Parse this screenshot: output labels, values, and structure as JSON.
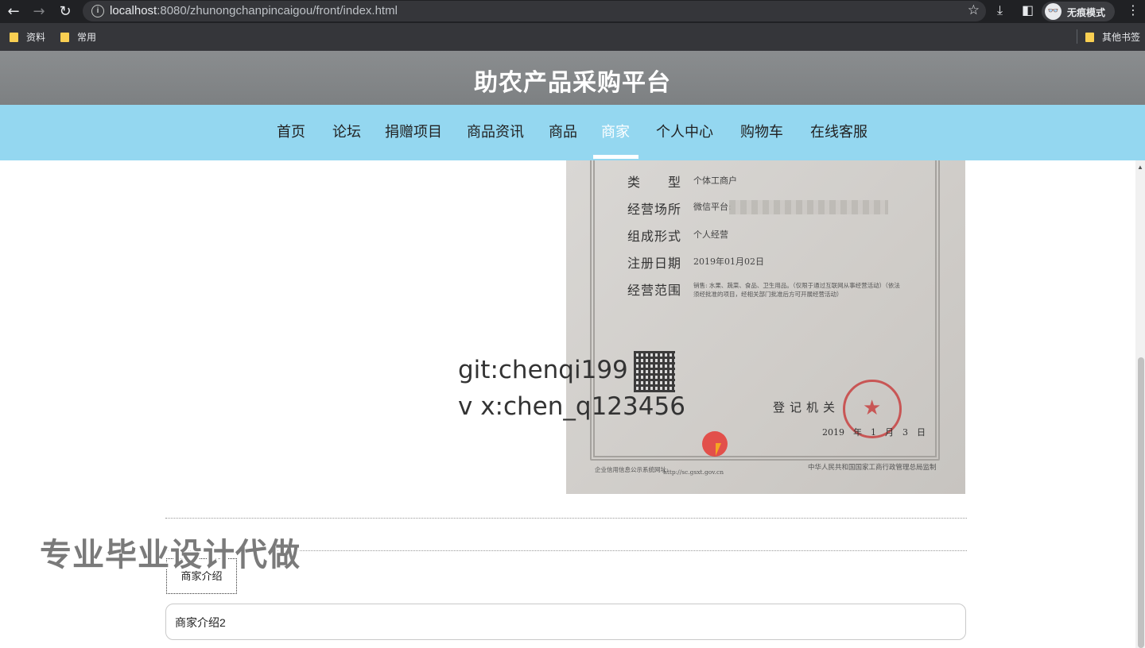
{
  "browser": {
    "url_host": "localhost",
    "url_rest": ":8080/zhunongchanpincaigou/front/index.html",
    "incognito_label": "无痕模式",
    "bookmarks": [
      "资料",
      "常用"
    ],
    "other_bookmarks": "其他书签",
    "icons": {
      "back": "←",
      "forward": "→",
      "reload": "↻",
      "info": "i",
      "star": "☆",
      "download": "⤓",
      "sidebar": "◧",
      "menu": "⋮",
      "incognito": "👓"
    }
  },
  "site": {
    "title": "助农产品采购平台",
    "nav": [
      {
        "label": "首页",
        "active": false
      },
      {
        "label": "论坛",
        "active": false
      },
      {
        "label": "捐赠项目",
        "active": false
      },
      {
        "label": "商品资讯",
        "active": false
      },
      {
        "label": "商品",
        "active": false
      },
      {
        "label": "商家",
        "active": true
      },
      {
        "label": "个人中心",
        "active": false
      },
      {
        "label": "购物车",
        "active": false
      },
      {
        "label": "在线客服",
        "active": false
      }
    ]
  },
  "license_image": {
    "rows": [
      {
        "label": "类　　型",
        "value": "个体工商户"
      },
      {
        "label": "经营场所",
        "value": "微信平台:"
      },
      {
        "label": "组成形式",
        "value": "个人经营"
      },
      {
        "label": "注册日期",
        "value": "2019年01月02日"
      },
      {
        "label": "经营范围",
        "value": "销售: 水果、蔬菜、食品、卫生用品。（仅限于通过互联网从事经营活动）（依法须经批准的项目，经相关部门批准后方可开展经营活动）"
      }
    ],
    "seal_text": "登记机关",
    "date_text": "2019　年　1　月　3　日",
    "footer_left": "企业信用信息公示系统网址:",
    "footer_url": "http://sc.gsxt.gov.cn",
    "footer_right": "中华人民共和国国家工商行政管理总局监制"
  },
  "watermark": {
    "line1": "git:chenqi199",
    "line2": "v x:chen_q123456"
  },
  "overlay_text": "专业毕业设计代做",
  "merchant": {
    "tab_label": "商家介绍",
    "description": "商家介绍2"
  }
}
